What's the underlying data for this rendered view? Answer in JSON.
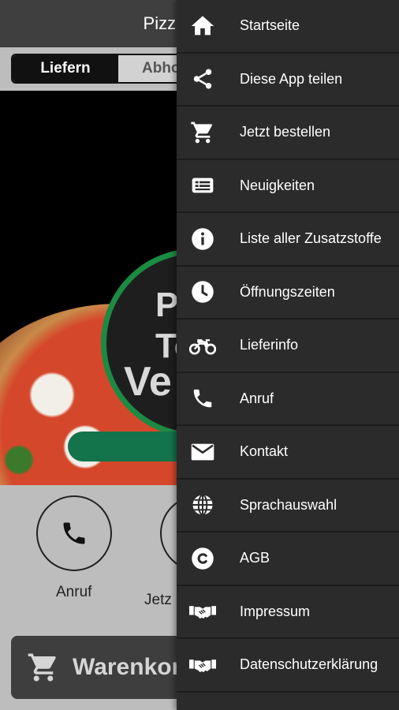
{
  "app": {
    "title": "Pizza T",
    "toggle": {
      "active": "Liefern",
      "inactive": "Abho"
    },
    "logo_text": [
      "P",
      "To",
      "Ve"
    ],
    "actions": [
      {
        "label": "Anruf",
        "icon": "phone-icon"
      },
      {
        "label": "Jetz",
        "icon": "order-icon"
      }
    ],
    "cart": {
      "label": "Warenkorb",
      "icon": "cart-icon"
    }
  },
  "drawer": {
    "items": [
      {
        "label": "Startseite",
        "icon": "home-icon"
      },
      {
        "label": "Diese App teilen",
        "icon": "share-icon"
      },
      {
        "label": "Jetzt bestellen",
        "icon": "cart-icon"
      },
      {
        "label": "Neuigkeiten",
        "icon": "news-icon"
      },
      {
        "label": "Liste aller Zusatzstoffe",
        "icon": "info-icon"
      },
      {
        "label": "Öffnungszeiten",
        "icon": "clock-icon"
      },
      {
        "label": "Lieferinfo",
        "icon": "motorbike-icon"
      },
      {
        "label": "Anruf",
        "icon": "phone-icon"
      },
      {
        "label": "Kontakt",
        "icon": "mail-icon"
      },
      {
        "label": "Sprachauswahl",
        "icon": "globe-icon"
      },
      {
        "label": "AGB",
        "icon": "copyright-icon"
      },
      {
        "label": "Impressum",
        "icon": "handshake-icon"
      },
      {
        "label": "Datenschutzerklärung",
        "icon": "handshake-icon"
      }
    ]
  },
  "colors": {
    "drawer_bg": "#2b2b2b",
    "topbar_bg": "#3f3f3f",
    "brand_green": "#1b8b43",
    "button_green": "#13734a"
  }
}
